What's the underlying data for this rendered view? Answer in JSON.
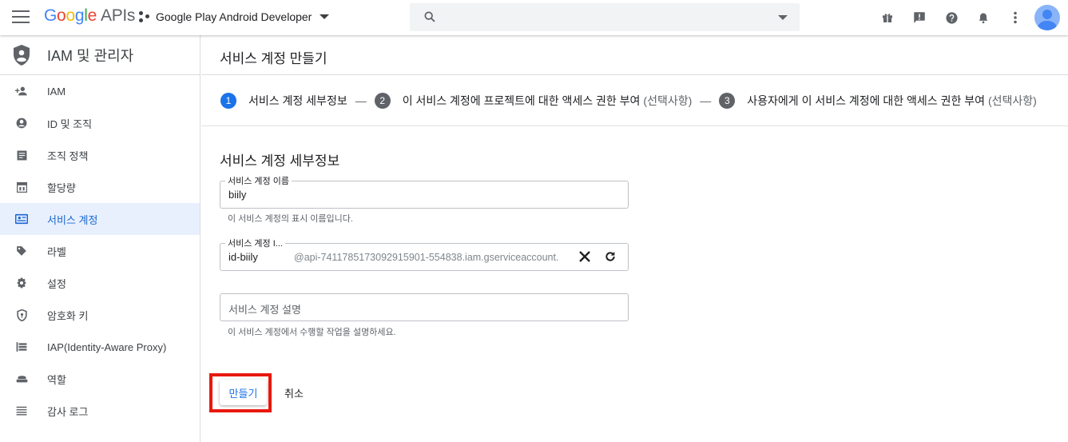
{
  "header": {
    "logo_letters": [
      "G",
      "o",
      "o",
      "g",
      "l",
      "e"
    ],
    "logo_suffix": "APIs",
    "project_name": "Google Play Android Developer",
    "search_placeholder": "",
    "icons": [
      "gift-icon",
      "feedback-icon",
      "help-icon",
      "notifications-icon",
      "more-vert-icon",
      "account-avatar"
    ]
  },
  "sidebar": {
    "title": "IAM 및 관리자",
    "items": [
      {
        "label": "IAM",
        "icon": "person-add-icon",
        "active": false
      },
      {
        "label": "ID 및 조직",
        "icon": "account-circle-icon",
        "active": false
      },
      {
        "label": "조직 정책",
        "icon": "article-icon",
        "active": false
      },
      {
        "label": "할당량",
        "icon": "calendar-icon",
        "active": false
      },
      {
        "label": "서비스 계정",
        "icon": "service-account-icon",
        "active": true
      },
      {
        "label": "라벨",
        "icon": "label-icon",
        "active": false
      },
      {
        "label": "설정",
        "icon": "settings-icon",
        "active": false
      },
      {
        "label": "암호화 키",
        "icon": "shield-key-icon",
        "active": false
      },
      {
        "label": "IAP(Identity-Aware Proxy)",
        "icon": "iap-icon",
        "active": false
      },
      {
        "label": "역할",
        "icon": "roles-icon",
        "active": false
      },
      {
        "label": "감사 로그",
        "icon": "list-icon",
        "active": false
      }
    ]
  },
  "main": {
    "page_title": "서비스 계정 만들기",
    "steps": [
      {
        "num": "1",
        "label": "서비스 계정 세부정보",
        "optional": ""
      },
      {
        "num": "2",
        "label": "이 서비스 계정에 프로젝트에 대한 액세스 권한 부여",
        "optional": "(선택사항)"
      },
      {
        "num": "3",
        "label": "사용자에게 이 서비스 계정에 대한 액세스 권한 부여",
        "optional": "(선택사항)"
      }
    ],
    "step_separator": "—",
    "section_title": "서비스 계정 세부정보",
    "name_field": {
      "label": "서비스 계정 이름",
      "value": "biily",
      "hint": "이 서비스 계정의 표시 이름입니다."
    },
    "id_field": {
      "label": "서비스 계정 I...",
      "value": "id-biily",
      "suffix": "@api-7411785173092915901-554838.iam.gserviceaccount."
    },
    "desc_field": {
      "placeholder": "서비스 계정 설명",
      "hint": "이 서비스 계정에서 수행할 작업을 설명하세요."
    },
    "create_label": "만들기",
    "cancel_label": "취소"
  },
  "colors": {
    "accent": "#1a73e8",
    "active_nav_bg": "#e8f0fe",
    "highlight_border": "#e8180d"
  }
}
